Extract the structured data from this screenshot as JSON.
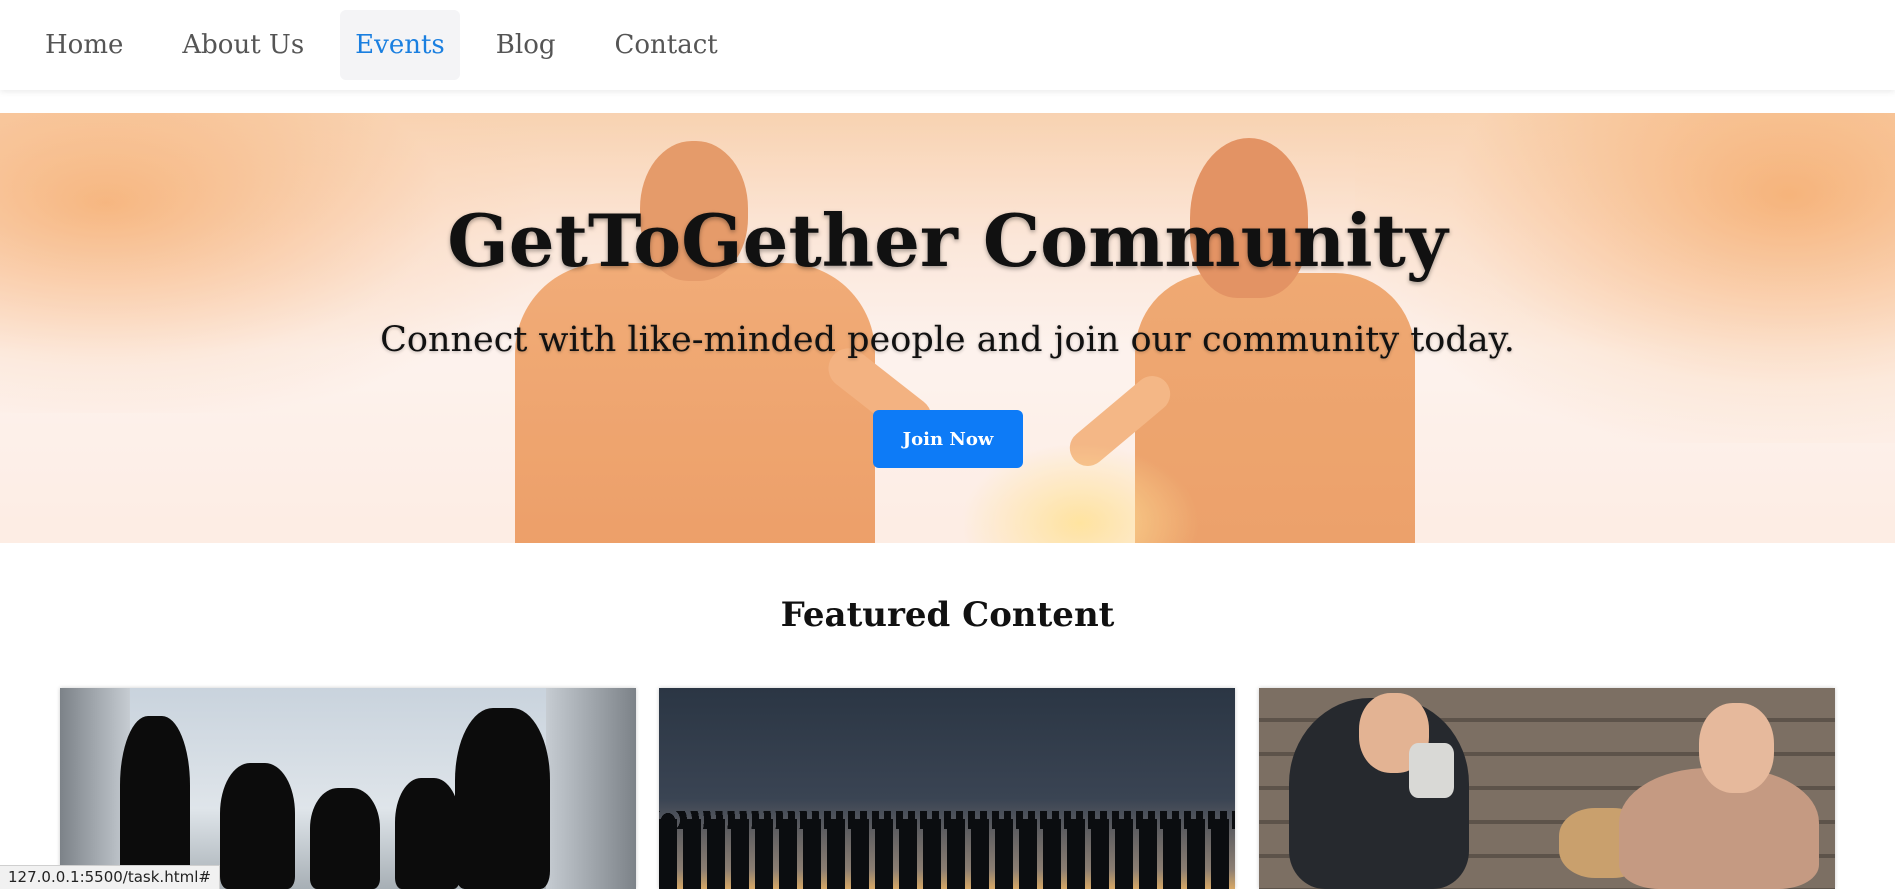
{
  "nav": {
    "items": [
      {
        "label": "Home",
        "active": false
      },
      {
        "label": "About Us",
        "active": false
      },
      {
        "label": "Events",
        "active": true
      },
      {
        "label": "Blog",
        "active": false
      },
      {
        "label": "Contact",
        "active": false
      }
    ]
  },
  "hero": {
    "title": "GetToGether Community",
    "subtitle": "Connect with like-minded people and join our community today.",
    "cta_label": "Join Now"
  },
  "featured": {
    "title": "Featured Content"
  },
  "status_bar": {
    "url": "127.0.0.1:5500/task.html#"
  },
  "colors": {
    "accent": "#0d7bf7",
    "nav_active": "#1a7fe0",
    "nav_text": "#555555"
  }
}
